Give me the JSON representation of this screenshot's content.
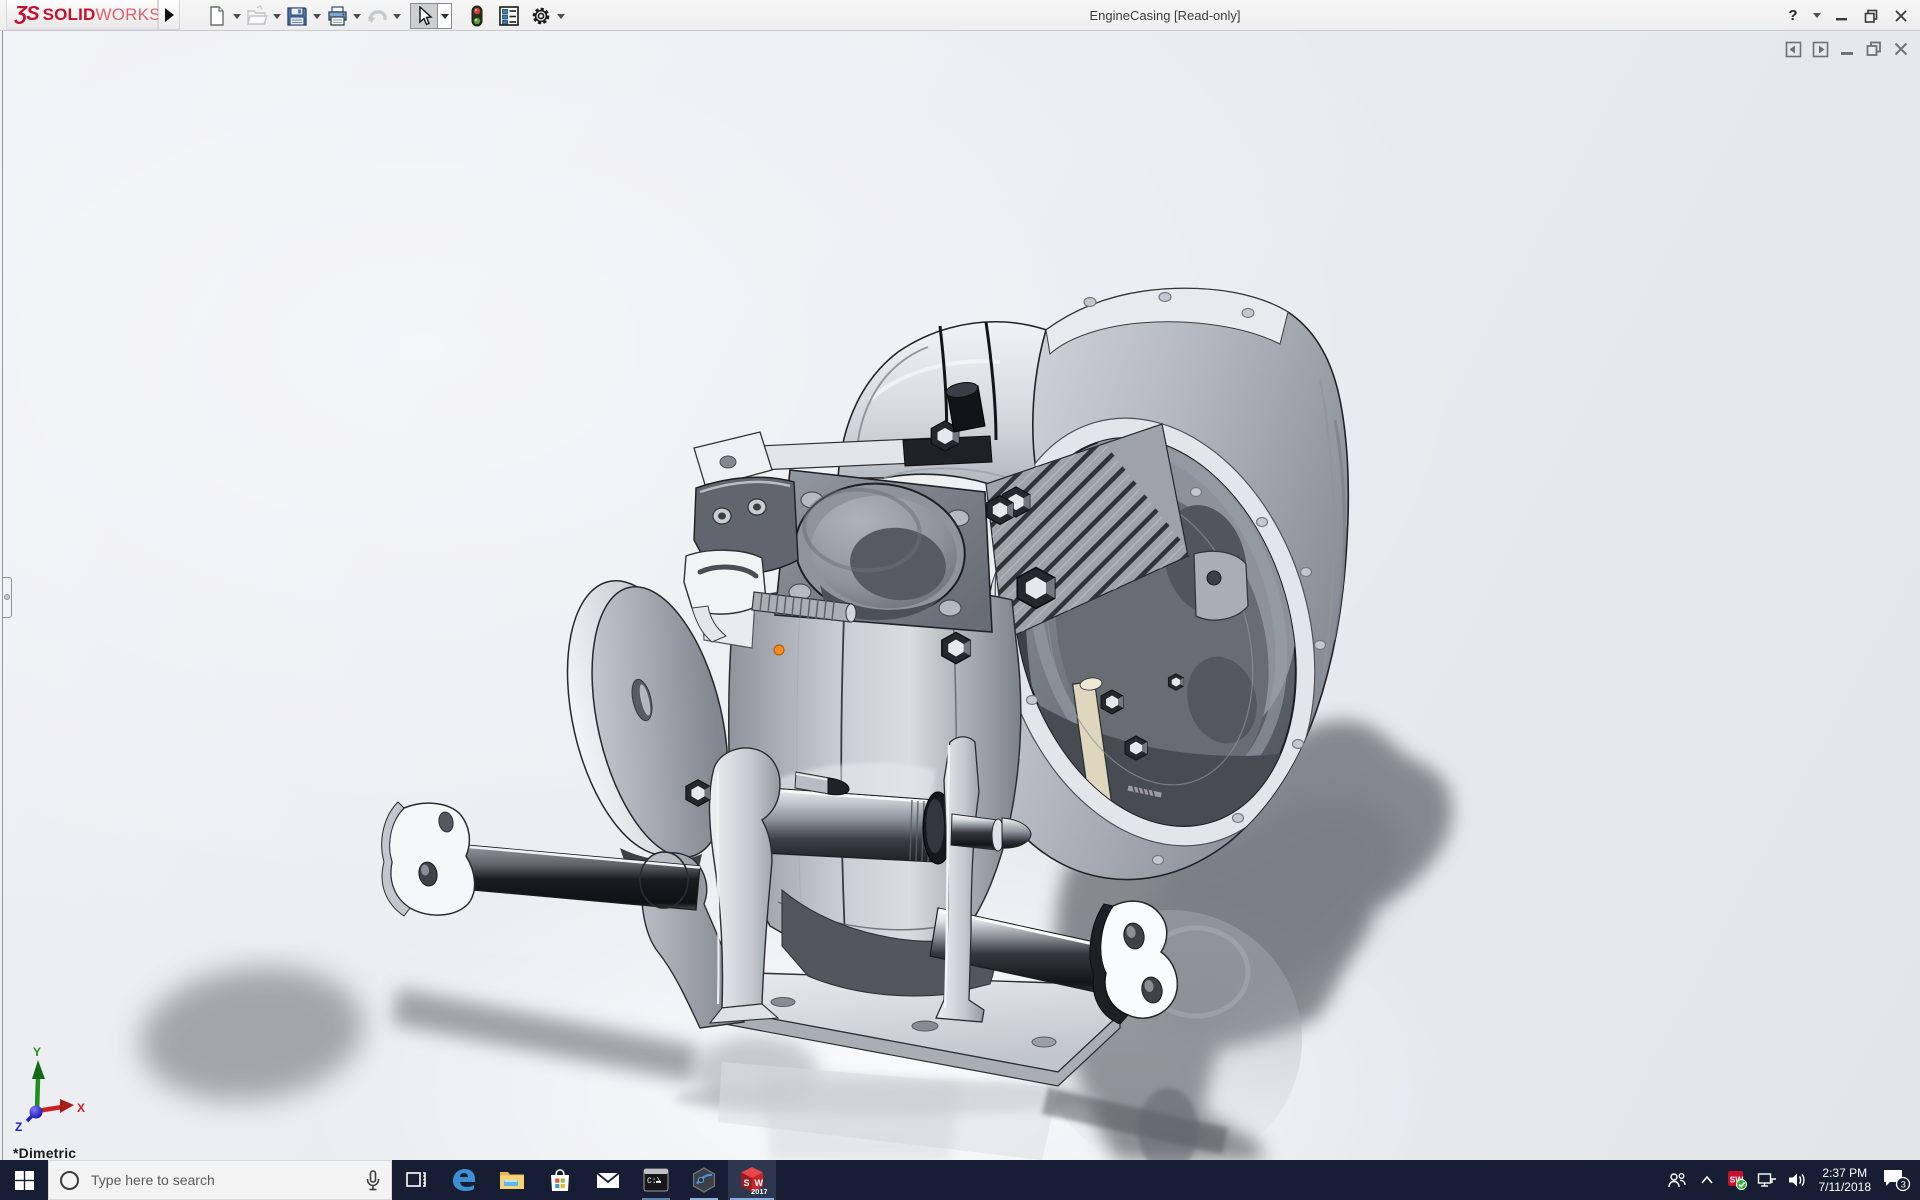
{
  "titlebar": {
    "brand": {
      "mark": "ƷS",
      "solid": "SOLID",
      "works": "WORKS"
    },
    "flyout_icon": "right-triangle",
    "tools": [
      {
        "name": "new-document",
        "dropdown": true
      },
      {
        "name": "open",
        "dropdown": true,
        "disabled": true
      },
      {
        "name": "save",
        "dropdown": true
      },
      {
        "name": "print",
        "dropdown": true
      },
      {
        "name": "undo",
        "dropdown": true,
        "disabled": true
      },
      {
        "name": "select",
        "dropdown": true,
        "pressed": true
      },
      {
        "name": "rebuild-traffic-light",
        "dropdown": false
      },
      {
        "name": "file-properties",
        "dropdown": false
      },
      {
        "name": "options-gear",
        "dropdown": true
      }
    ],
    "title": "EngineCasing [Read-only]",
    "help_glyph": "?",
    "window_controls": [
      "minimize",
      "restore",
      "close"
    ]
  },
  "document_window_controls": [
    "previous-pane",
    "next-pane",
    "minimize",
    "restore",
    "close"
  ],
  "viewport": {
    "orientation": "*Dimetric",
    "triad": {
      "x": "X",
      "y": "Y",
      "z": "Z"
    },
    "model": {
      "name": "EngineCasing",
      "selection_marker_color": "#ff8a1e",
      "parts": [
        "left-rod-flange",
        "left-rod",
        "flywheel-cover-disc",
        "crankcase-body",
        "carburetor-flange",
        "cylinder-fins",
        "top-cover-hump",
        "right-casing",
        "casing-opening",
        "reed-valve-strip",
        "mounting-stand-left",
        "mounting-stand-right",
        "pivot-pin-left",
        "pivot-pin-right",
        "right-rod",
        "right-rod-flange",
        "base-plate",
        "mount-bracket",
        "threaded-stud"
      ]
    }
  },
  "taskbar": {
    "start": "windows-logo",
    "search": {
      "placeholder": "Type here to search",
      "mic_icon": "microphone"
    },
    "apps": [
      {
        "name": "task-view"
      },
      {
        "name": "microsoft-edge"
      },
      {
        "name": "file-explorer"
      },
      {
        "name": "microsoft-store"
      },
      {
        "name": "mail"
      },
      {
        "name": "command-prompt",
        "prompt_text": "C:\\",
        "running": true
      },
      {
        "name": "mixed-reality-viewer",
        "running": true
      },
      {
        "name": "solidworks-2017",
        "letters_s": "S",
        "letters_w": "W",
        "year": "2017",
        "active": true
      }
    ],
    "tray": {
      "icons": [
        "people",
        "hidden-icons-chevron",
        "solidworks-status",
        "network",
        "volume"
      ],
      "time": "2:37 PM",
      "date": "7/11/2018",
      "notification_badge": "3"
    },
    "colors": {
      "taskbar_bg": "#171e33",
      "active_underline": "#76a9dd",
      "sw_red": "#c8102e"
    }
  }
}
